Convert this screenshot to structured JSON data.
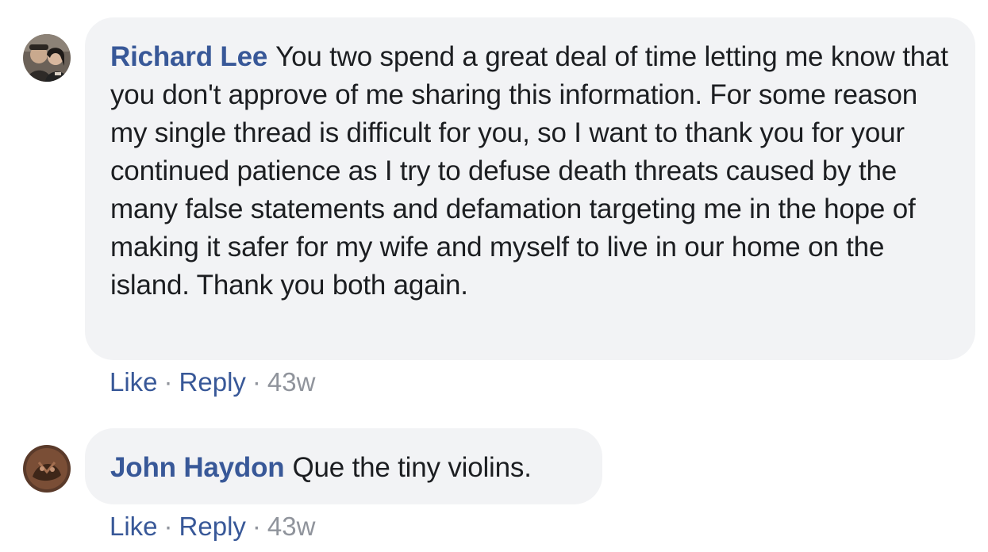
{
  "comments": [
    {
      "author": "Richard Lee",
      "text": "You two spend a great deal of time letting me know that you don't approve of me sharing this information. For some reason my single thread is difficult for you, so I want to thank you for your continued patience as I try to defuse death threats caused by the many false statements and defamation targeting me in the hope of making it safer for my wife and myself to live in our home on the island. Thank you both again.",
      "like_label": "Like",
      "reply_label": "Reply",
      "separator": "·",
      "timestamp": "43w"
    },
    {
      "author": "John Haydon",
      "text": "Que the tiny violins.",
      "like_label": "Like",
      "reply_label": "Reply",
      "separator": "·",
      "timestamp": "43w"
    }
  ],
  "colors": {
    "author": "#385898",
    "bubble": "#f2f3f5",
    "meta": "#90949c",
    "text": "#1c1e21"
  }
}
